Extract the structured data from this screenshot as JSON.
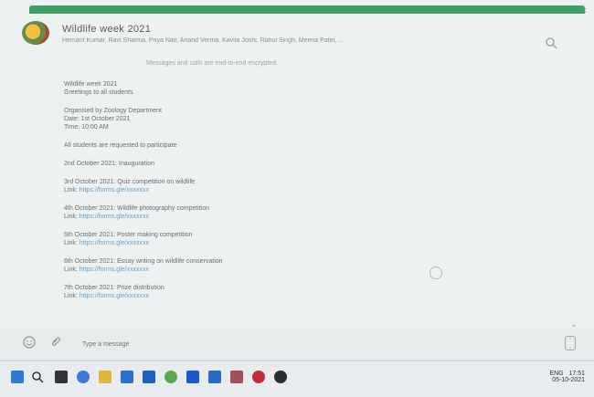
{
  "window": {
    "title": "Wildlife week 2021",
    "participants": "Hemant Kumar, Ravi Sharma, Priya Nair, Anand Verma, Kavita Joshi, Rahul Singh, Meena Patel, ...",
    "subline": "Messages and calls are end-to-end encrypted.",
    "close_glyph": "×"
  },
  "chat": {
    "messages": [
      {
        "lines": [
          "Wildlife week 2021",
          "Greetings to all students"
        ]
      },
      {
        "lines": [
          "Organised by Zoology Department",
          "Date: 1st October 2021",
          "Time: 10:00 AM"
        ]
      },
      {
        "lines": [
          "All students are requested to participate"
        ]
      },
      {
        "lines": [
          "2nd October 2021: Inauguration"
        ]
      },
      {
        "lines": [
          "3rd October 2021: Quiz competition on wildlife",
          "Link:"
        ],
        "link": "https://forms.gle/xxxxxxx"
      },
      {
        "lines": [
          "4th October 2021: Wildlife photography competition",
          "Link:"
        ],
        "link": "https://forms.gle/xxxxxxx"
      },
      {
        "lines": [
          "5th October 2021: Poster making competition",
          "Link:"
        ],
        "link": "https://forms.gle/xxxxxxx"
      },
      {
        "lines": [
          "6th October 2021: Essay writing on wildlife conservation",
          "Link:"
        ],
        "link": "https://forms.gle/xxxxxxx"
      },
      {
        "lines": [
          "7th October 2021: Prize distribution",
          "Link:"
        ],
        "link": "https://forms.gle/xxxxxxx"
      }
    ]
  },
  "composer": {
    "placeholder": "Type a message"
  },
  "tray": {
    "time": "17:51",
    "date": "05-10-2021",
    "lang": "ENG"
  }
}
